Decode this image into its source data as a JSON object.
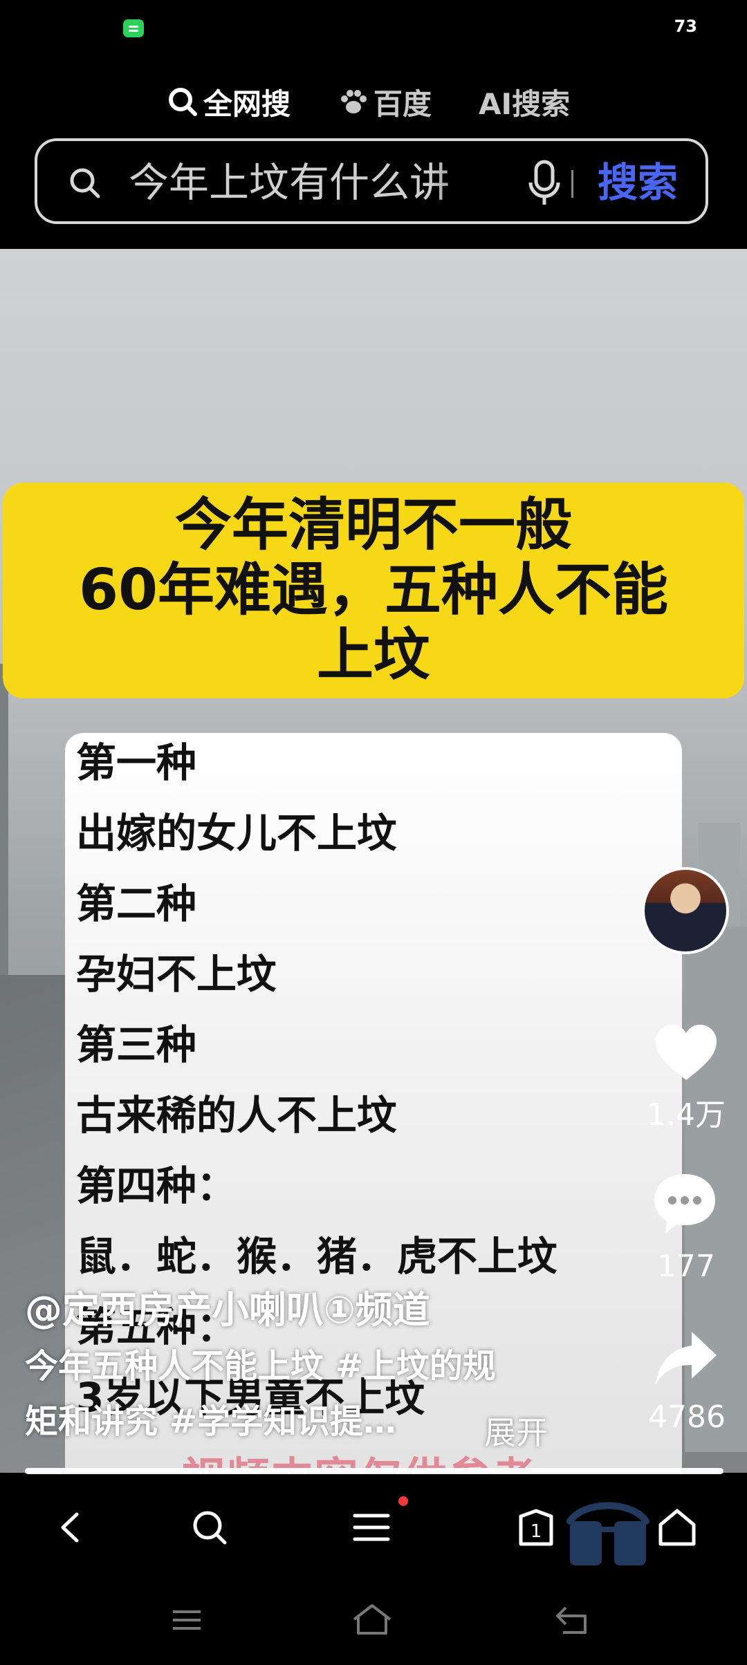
{
  "status_bar": {
    "battery": "73"
  },
  "search_tabs": [
    {
      "label": "全网搜",
      "icon": "search-icon",
      "active": true
    },
    {
      "label": "百度",
      "icon": "paw-icon",
      "active": false
    },
    {
      "label": "AI搜索",
      "icon": "",
      "active": false
    }
  ],
  "search": {
    "query": "今年上坟有什么讲",
    "button_label": "搜索"
  },
  "video": {
    "banner_lines": [
      "今年清明不一般",
      "60年难遇，五种人不能",
      "上坟"
    ],
    "card_lines": [
      "第一种",
      "出嫁的女儿不上坟",
      "第二种",
      "孕妇不上坟",
      "第三种",
      "古来稀的人不上坟",
      "第四种：",
      "鼠．蛇．猴．猪．虎不上坟",
      "第五种：",
      "3岁以下男童不上坟"
    ],
    "faded_text": "视频内容仅供参考"
  },
  "actions": {
    "likes": "1.4万",
    "comments": "177",
    "shares": "4786"
  },
  "caption": {
    "author": "@定西房产小喇叭①频道",
    "line1": "今年五种人不能上坟 #上坟的规",
    "line2": "矩和讲究  #学学知识提…",
    "expand": "展开"
  },
  "colors": {
    "banner": "#f7d816",
    "search_button": "#4a66f5",
    "accent_red": "#f03a3a"
  }
}
